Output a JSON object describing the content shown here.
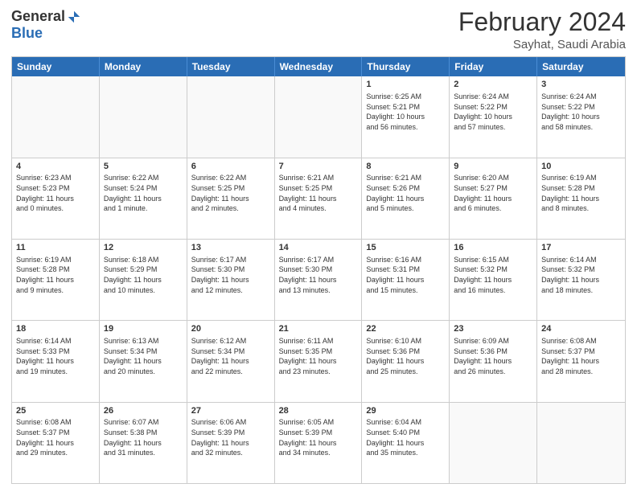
{
  "logo": {
    "general": "General",
    "blue": "Blue"
  },
  "title": "February 2024",
  "subtitle": "Sayhat, Saudi Arabia",
  "days": [
    "Sunday",
    "Monday",
    "Tuesday",
    "Wednesday",
    "Thursday",
    "Friday",
    "Saturday"
  ],
  "rows": [
    [
      {
        "day": "",
        "info": ""
      },
      {
        "day": "",
        "info": ""
      },
      {
        "day": "",
        "info": ""
      },
      {
        "day": "",
        "info": ""
      },
      {
        "day": "1",
        "info": "Sunrise: 6:25 AM\nSunset: 5:21 PM\nDaylight: 10 hours\nand 56 minutes."
      },
      {
        "day": "2",
        "info": "Sunrise: 6:24 AM\nSunset: 5:22 PM\nDaylight: 10 hours\nand 57 minutes."
      },
      {
        "day": "3",
        "info": "Sunrise: 6:24 AM\nSunset: 5:22 PM\nDaylight: 10 hours\nand 58 minutes."
      }
    ],
    [
      {
        "day": "4",
        "info": "Sunrise: 6:23 AM\nSunset: 5:23 PM\nDaylight: 11 hours\nand 0 minutes."
      },
      {
        "day": "5",
        "info": "Sunrise: 6:22 AM\nSunset: 5:24 PM\nDaylight: 11 hours\nand 1 minute."
      },
      {
        "day": "6",
        "info": "Sunrise: 6:22 AM\nSunset: 5:25 PM\nDaylight: 11 hours\nand 2 minutes."
      },
      {
        "day": "7",
        "info": "Sunrise: 6:21 AM\nSunset: 5:25 PM\nDaylight: 11 hours\nand 4 minutes."
      },
      {
        "day": "8",
        "info": "Sunrise: 6:21 AM\nSunset: 5:26 PM\nDaylight: 11 hours\nand 5 minutes."
      },
      {
        "day": "9",
        "info": "Sunrise: 6:20 AM\nSunset: 5:27 PM\nDaylight: 11 hours\nand 6 minutes."
      },
      {
        "day": "10",
        "info": "Sunrise: 6:19 AM\nSunset: 5:28 PM\nDaylight: 11 hours\nand 8 minutes."
      }
    ],
    [
      {
        "day": "11",
        "info": "Sunrise: 6:19 AM\nSunset: 5:28 PM\nDaylight: 11 hours\nand 9 minutes."
      },
      {
        "day": "12",
        "info": "Sunrise: 6:18 AM\nSunset: 5:29 PM\nDaylight: 11 hours\nand 10 minutes."
      },
      {
        "day": "13",
        "info": "Sunrise: 6:17 AM\nSunset: 5:30 PM\nDaylight: 11 hours\nand 12 minutes."
      },
      {
        "day": "14",
        "info": "Sunrise: 6:17 AM\nSunset: 5:30 PM\nDaylight: 11 hours\nand 13 minutes."
      },
      {
        "day": "15",
        "info": "Sunrise: 6:16 AM\nSunset: 5:31 PM\nDaylight: 11 hours\nand 15 minutes."
      },
      {
        "day": "16",
        "info": "Sunrise: 6:15 AM\nSunset: 5:32 PM\nDaylight: 11 hours\nand 16 minutes."
      },
      {
        "day": "17",
        "info": "Sunrise: 6:14 AM\nSunset: 5:32 PM\nDaylight: 11 hours\nand 18 minutes."
      }
    ],
    [
      {
        "day": "18",
        "info": "Sunrise: 6:14 AM\nSunset: 5:33 PM\nDaylight: 11 hours\nand 19 minutes."
      },
      {
        "day": "19",
        "info": "Sunrise: 6:13 AM\nSunset: 5:34 PM\nDaylight: 11 hours\nand 20 minutes."
      },
      {
        "day": "20",
        "info": "Sunrise: 6:12 AM\nSunset: 5:34 PM\nDaylight: 11 hours\nand 22 minutes."
      },
      {
        "day": "21",
        "info": "Sunrise: 6:11 AM\nSunset: 5:35 PM\nDaylight: 11 hours\nand 23 minutes."
      },
      {
        "day": "22",
        "info": "Sunrise: 6:10 AM\nSunset: 5:36 PM\nDaylight: 11 hours\nand 25 minutes."
      },
      {
        "day": "23",
        "info": "Sunrise: 6:09 AM\nSunset: 5:36 PM\nDaylight: 11 hours\nand 26 minutes."
      },
      {
        "day": "24",
        "info": "Sunrise: 6:08 AM\nSunset: 5:37 PM\nDaylight: 11 hours\nand 28 minutes."
      }
    ],
    [
      {
        "day": "25",
        "info": "Sunrise: 6:08 AM\nSunset: 5:37 PM\nDaylight: 11 hours\nand 29 minutes."
      },
      {
        "day": "26",
        "info": "Sunrise: 6:07 AM\nSunset: 5:38 PM\nDaylight: 11 hours\nand 31 minutes."
      },
      {
        "day": "27",
        "info": "Sunrise: 6:06 AM\nSunset: 5:39 PM\nDaylight: 11 hours\nand 32 minutes."
      },
      {
        "day": "28",
        "info": "Sunrise: 6:05 AM\nSunset: 5:39 PM\nDaylight: 11 hours\nand 34 minutes."
      },
      {
        "day": "29",
        "info": "Sunrise: 6:04 AM\nSunset: 5:40 PM\nDaylight: 11 hours\nand 35 minutes."
      },
      {
        "day": "",
        "info": ""
      },
      {
        "day": "",
        "info": ""
      }
    ]
  ]
}
